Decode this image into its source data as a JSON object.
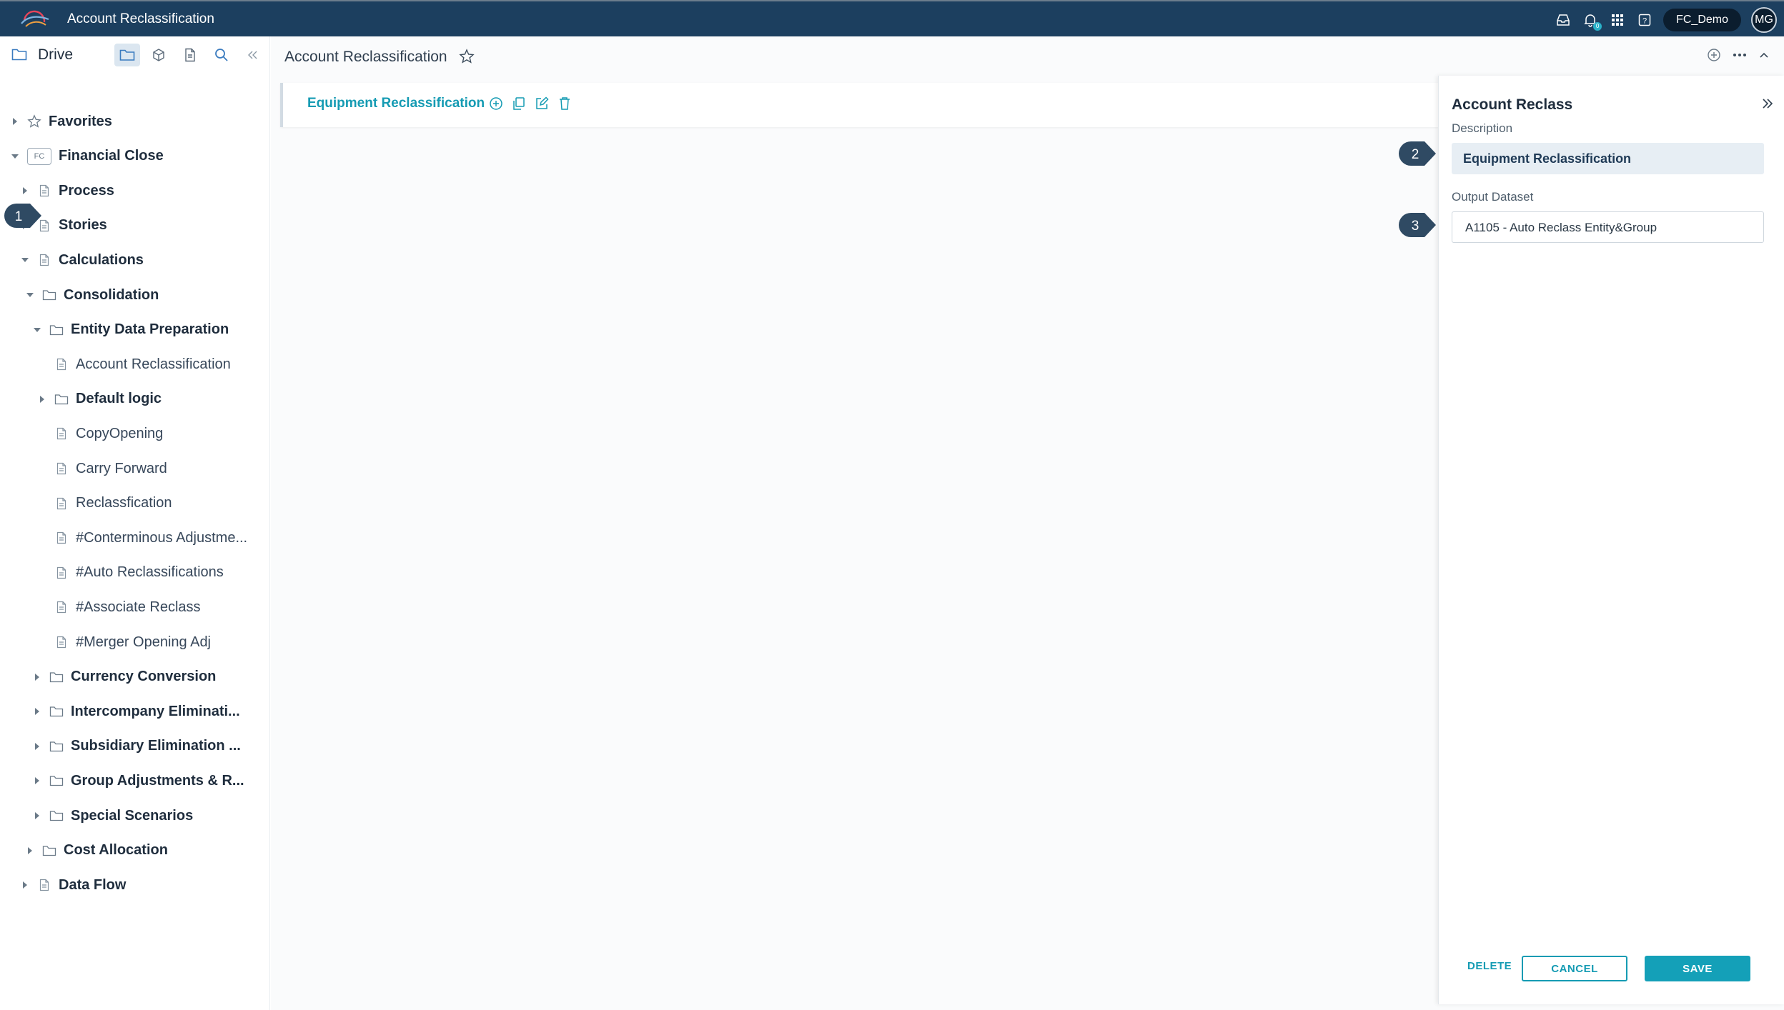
{
  "topbar": {
    "app_title": "Account Reclassification",
    "notification_count": "0",
    "tenant": "FC_Demo",
    "user_initials": "MG"
  },
  "sidebar": {
    "title": "Drive",
    "tree": [
      {
        "label": "Favorites",
        "type": "star",
        "depth": 0,
        "expanded": false,
        "bold": true
      },
      {
        "label": "Financial Close",
        "type": "chip",
        "chip": "FC",
        "depth": 0,
        "expanded": true,
        "bold": true
      },
      {
        "label": "Process",
        "type": "doc",
        "depth": 1,
        "expanded": false,
        "bold": true
      },
      {
        "label": "Stories",
        "type": "doc",
        "depth": 1,
        "expanded": false,
        "bold": true
      },
      {
        "label": "Calculations",
        "type": "doc",
        "depth": 1,
        "expanded": true,
        "bold": true
      },
      {
        "label": "Consolidation",
        "type": "folder",
        "depth": 2,
        "expanded": true,
        "bold": true
      },
      {
        "label": "Entity Data Preparation",
        "type": "folder",
        "depth": 3,
        "expanded": true,
        "bold": true
      },
      {
        "label": "Account Reclassification",
        "type": "doc",
        "depth": 4,
        "leaf": true,
        "bold": false
      },
      {
        "label": "Default logic",
        "type": "folder",
        "depth": 4,
        "expanded": false,
        "bold": true
      },
      {
        "label": "CopyOpening",
        "type": "doc",
        "depth": 4,
        "leaf": true,
        "bold": false
      },
      {
        "label": "Carry Forward",
        "type": "doc",
        "depth": 4,
        "leaf": true,
        "bold": false
      },
      {
        "label": "Reclassfication",
        "type": "doc",
        "depth": 4,
        "leaf": true,
        "bold": false
      },
      {
        "label": "#Conterminous Adjustme...",
        "type": "doc",
        "depth": 4,
        "leaf": true,
        "bold": false
      },
      {
        "label": "#Auto Reclassifications",
        "type": "doc",
        "depth": 4,
        "leaf": true,
        "bold": false
      },
      {
        "label": "#Associate Reclass",
        "type": "doc",
        "depth": 4,
        "leaf": true,
        "bold": false
      },
      {
        "label": "#Merger Opening Adj",
        "type": "doc",
        "depth": 4,
        "leaf": true,
        "bold": false
      },
      {
        "label": "Currency Conversion",
        "type": "folder",
        "depth": 3,
        "expanded": false,
        "bold": true
      },
      {
        "label": "Intercompany Eliminati...",
        "type": "folder",
        "depth": 3,
        "expanded": false,
        "bold": true
      },
      {
        "label": "Subsidiary Elimination  ...",
        "type": "folder",
        "depth": 3,
        "expanded": false,
        "bold": true
      },
      {
        "label": "Group Adjustments & R...",
        "type": "folder",
        "depth": 3,
        "expanded": false,
        "bold": true
      },
      {
        "label": "Special Scenarios",
        "type": "folder",
        "depth": 3,
        "expanded": false,
        "bold": true
      },
      {
        "label": "Cost Allocation",
        "type": "folder",
        "depth": 2,
        "expanded": false,
        "bold": true
      },
      {
        "label": "Data Flow",
        "type": "doc",
        "depth": 1,
        "expanded": false,
        "bold": true
      }
    ]
  },
  "main": {
    "title": "Account Reclassification",
    "card_title": "Equipment Reclassification"
  },
  "panel": {
    "title": "Account Reclass",
    "description_label": "Description",
    "description_value": "Equipment Reclassification",
    "output_label": "Output Dataset",
    "output_value": "A1105 - Auto Reclass Entity&Group",
    "delete_label": "DELETE",
    "cancel_label": "CANCEL",
    "save_label": "SAVE"
  },
  "callouts": [
    "1",
    "2",
    "3"
  ],
  "colors": {
    "topbar": "#1c3f5f",
    "accent": "#159bb3",
    "callout": "#2f4a63"
  }
}
